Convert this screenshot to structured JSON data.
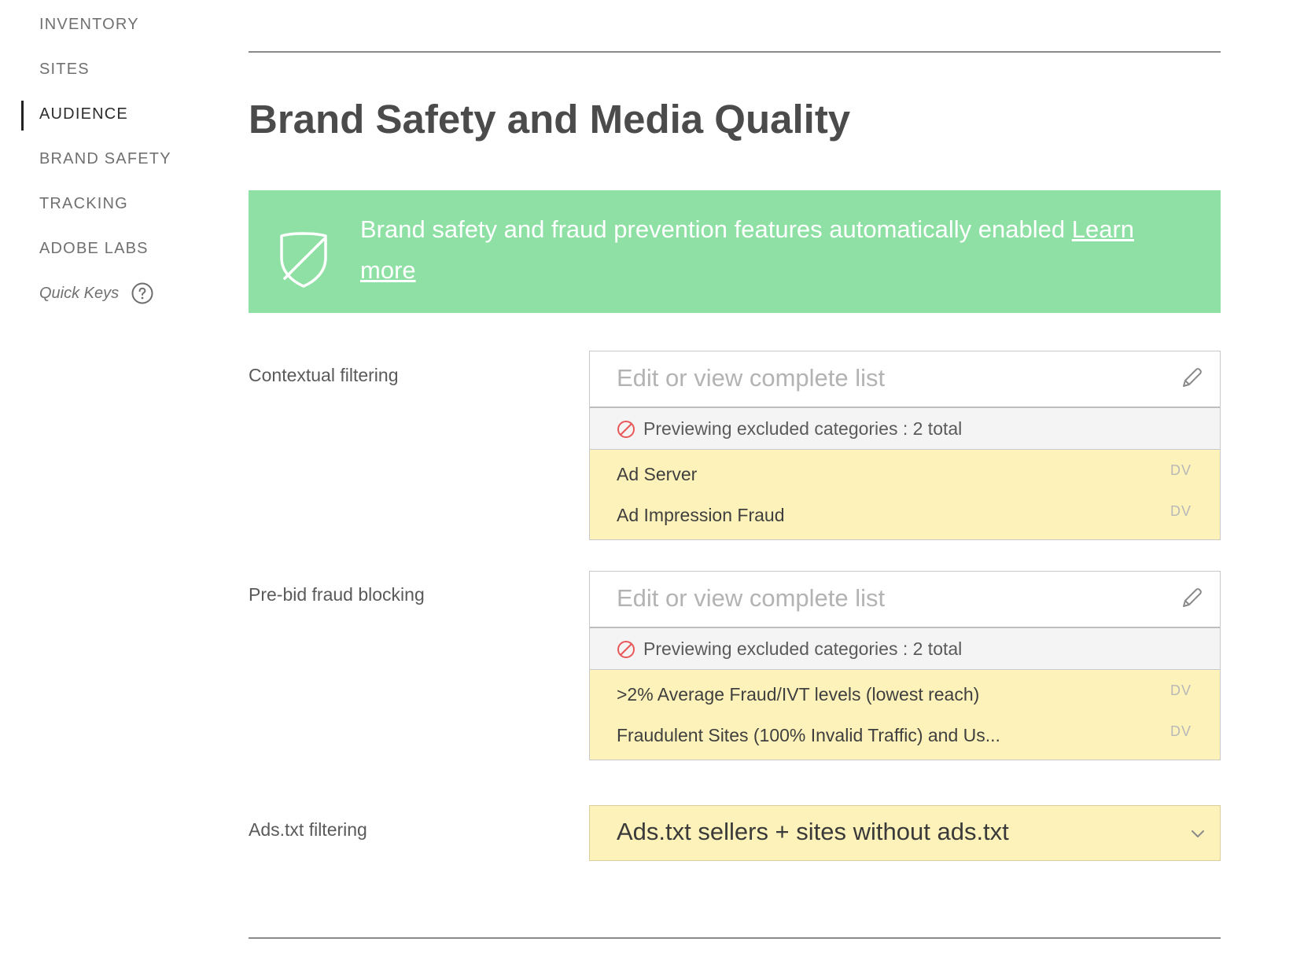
{
  "sidebar": {
    "items": [
      {
        "label": "INVENTORY"
      },
      {
        "label": "SITES"
      },
      {
        "label": "AUDIENCE"
      },
      {
        "label": "BRAND SAFETY"
      },
      {
        "label": "TRACKING"
      },
      {
        "label": "ADOBE LABS"
      }
    ],
    "active_item": "AUDIENCE",
    "quick_keys_label": "Quick Keys",
    "quick_keys_icon": "help-icon"
  },
  "main": {
    "title": "Brand Safety and Media Quality",
    "banner": {
      "text": "Brand safety and fraud prevention features automatically enabled",
      "link_text": "Learn more",
      "icon": "shield-icon",
      "background_color": "#8ee0a4"
    },
    "contextual_filtering": {
      "label": "Contextual filtering",
      "placeholder": "Edit or view complete list",
      "preview_text": "Previewing excluded categories : 2 total",
      "rows": [
        {
          "label": "Ad Server",
          "tag": "DV"
        },
        {
          "label": "Ad Impression Fraud",
          "tag": "DV"
        }
      ]
    },
    "prebid_fraud_blocking": {
      "label": "Pre-bid fraud blocking",
      "placeholder": "Edit or view complete list",
      "preview_text": "Previewing excluded categories : 2 total",
      "rows": [
        {
          "label": ">2% Average Fraud/IVT levels (lowest reach)",
          "tag": "DV"
        },
        {
          "label": "Fraudulent Sites (100% Invalid Traffic) and Us...",
          "tag": "DV"
        }
      ]
    },
    "ads_txt_filtering": {
      "label": "Ads.txt filtering",
      "selected_value": "Ads.txt sellers + sites without ads.txt"
    },
    "colors": {
      "highlight_yellow": "#fdf2b9",
      "block_icon_red": "#e8575a"
    }
  }
}
